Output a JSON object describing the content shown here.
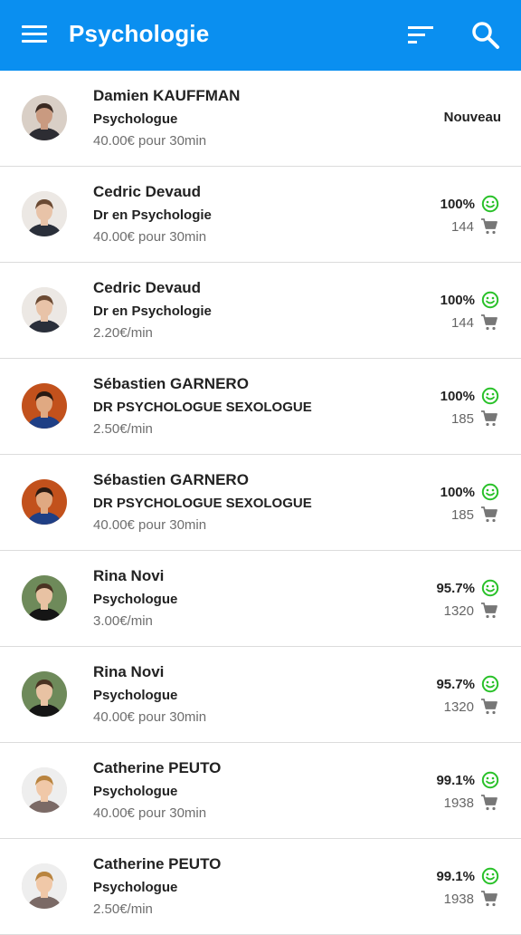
{
  "header": {
    "title": "Psychologie",
    "menu_icon": "menu-icon",
    "filter_icon": "filter-icon",
    "search_icon": "search-icon",
    "color": "#0a8ff0"
  },
  "colors": {
    "rating_green": "#2ac12a",
    "text": "#222222",
    "muted": "#6e6e6e"
  },
  "experts": [
    {
      "name": "Damien KAUFFMAN",
      "specialty": "Psychologue",
      "price": "40.00€ pour 30min",
      "badge": "Nouveau",
      "rating": "",
      "sales": ""
    },
    {
      "name": "Cedric Devaud",
      "specialty": "Dr en Psychologie",
      "price": "40.00€ pour 30min",
      "badge": "",
      "rating": "100%",
      "sales": "144"
    },
    {
      "name": "Cedric Devaud",
      "specialty": "Dr en Psychologie",
      "price": "2.20€/min",
      "badge": "",
      "rating": "100%",
      "sales": "144"
    },
    {
      "name": "Sébastien GARNERO",
      "specialty": "DR PSYCHOLOGUE SEXOLOGUE",
      "price": "2.50€/min",
      "badge": "",
      "rating": "100%",
      "sales": "185"
    },
    {
      "name": "Sébastien GARNERO",
      "specialty": "DR PSYCHOLOGUE SEXOLOGUE",
      "price": "40.00€ pour 30min",
      "badge": "",
      "rating": "100%",
      "sales": "185"
    },
    {
      "name": "Rina Novi",
      "specialty": "Psychologue",
      "price": "3.00€/min",
      "badge": "",
      "rating": "95.7%",
      "sales": "1320"
    },
    {
      "name": "Rina Novi",
      "specialty": "Psychologue",
      "price": "40.00€ pour 30min",
      "badge": "",
      "rating": "95.7%",
      "sales": "1320"
    },
    {
      "name": "Catherine PEUTO",
      "specialty": "Psychologue",
      "price": "40.00€ pour 30min",
      "badge": "",
      "rating": "99.1%",
      "sales": "1938"
    },
    {
      "name": "Catherine PEUTO",
      "specialty": "Psychologue",
      "price": "2.50€/min",
      "badge": "",
      "rating": "99.1%",
      "sales": "1938"
    }
  ]
}
